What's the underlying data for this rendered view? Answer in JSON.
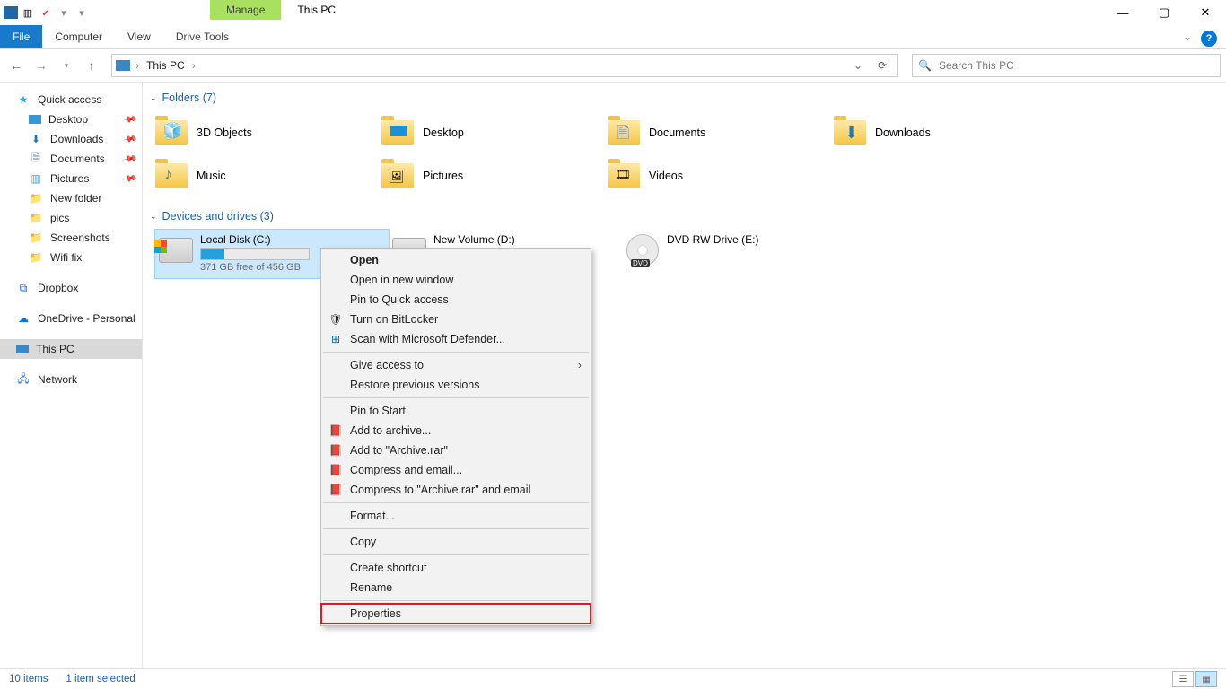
{
  "window": {
    "title": "This PC",
    "manage_tab": "Manage"
  },
  "ribbon": {
    "file": "File",
    "computer": "Computer",
    "view": "View",
    "drive_tools": "Drive Tools"
  },
  "nav": {
    "location": "This PC",
    "search_placeholder": "Search This PC"
  },
  "sidebar": {
    "quick_access": "Quick access",
    "desktop": "Desktop",
    "downloads": "Downloads",
    "documents": "Documents",
    "pictures": "Pictures",
    "new_folder": "New folder",
    "pics": "pics",
    "screenshots": "Screenshots",
    "wifi_fix": "Wifi fix",
    "dropbox": "Dropbox",
    "onedrive": "OneDrive - Personal",
    "this_pc": "This PC",
    "network": "Network"
  },
  "groups": {
    "folders": "Folders (7)",
    "devices": "Devices and drives (3)"
  },
  "folders": {
    "objects3d": "3D Objects",
    "desktop": "Desktop",
    "documents": "Documents",
    "downloads": "Downloads",
    "music": "Music",
    "pictures": "Pictures",
    "videos": "Videos"
  },
  "drives": {
    "c": {
      "name": "Local Disk (C:)",
      "free": "371 GB free of 456 GB"
    },
    "d": {
      "name": "New Volume (D:)"
    },
    "e": {
      "name": "DVD RW Drive (E:)"
    }
  },
  "context": {
    "open": "Open",
    "open_new": "Open in new window",
    "pin_quick": "Pin to Quick access",
    "bitlocker": "Turn on BitLocker",
    "defender": "Scan with Microsoft Defender...",
    "give_access": "Give access to",
    "restore": "Restore previous versions",
    "pin_start": "Pin to Start",
    "add_archive": "Add to archive...",
    "add_archive_rar": "Add to \"Archive.rar\"",
    "compress_email": "Compress and email...",
    "compress_rar_email": "Compress to \"Archive.rar\" and email",
    "format": "Format...",
    "copy": "Copy",
    "shortcut": "Create shortcut",
    "rename": "Rename",
    "properties": "Properties"
  },
  "status": {
    "items": "10 items",
    "selected": "1 item selected"
  }
}
